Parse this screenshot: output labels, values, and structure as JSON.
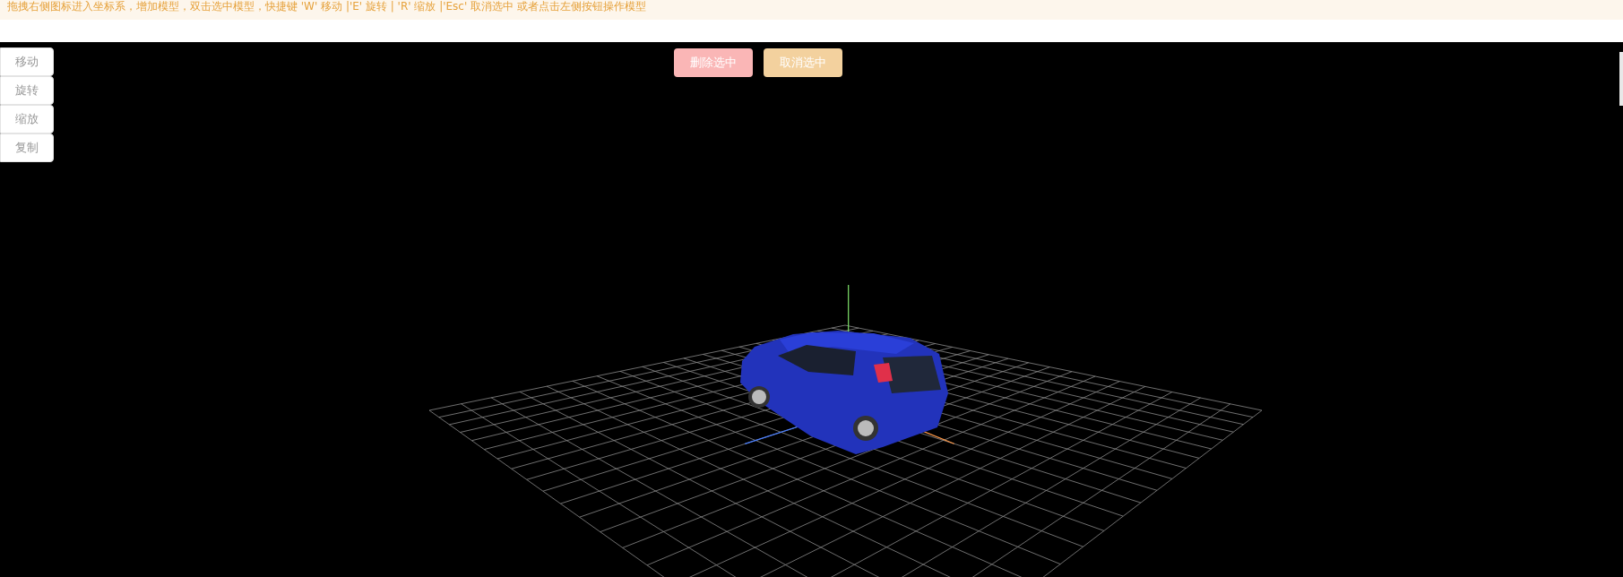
{
  "hint": "拖拽右侧图标进入坐标系，增加模型，双击选中模型，快捷键 'W' 移动 |'E' 旋转 | 'R' 缩放 |'Esc' 取消选中 或者点击左侧按钮操作模型",
  "mode_buttons": [
    {
      "label": "移动"
    },
    {
      "label": "旋转"
    },
    {
      "label": "缩放"
    },
    {
      "label": "复制"
    }
  ],
  "action_buttons": [
    {
      "label": "删除选中",
      "kind": "danger"
    },
    {
      "label": "取消选中",
      "kind": "warning"
    }
  ]
}
